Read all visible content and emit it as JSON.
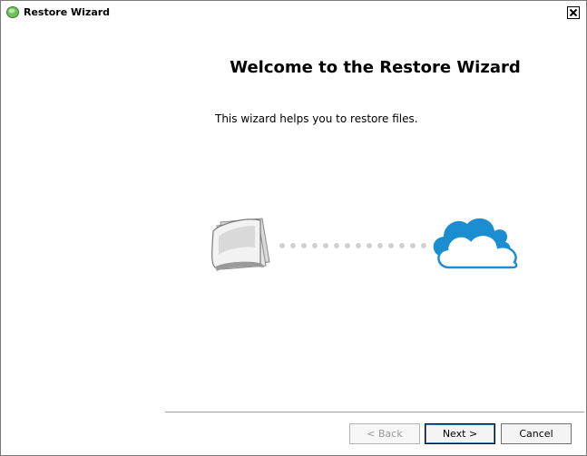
{
  "window": {
    "title": "Restore Wizard",
    "app_icon": "restore-wizard-icon",
    "close_icon": "close-icon"
  },
  "main": {
    "heading": "Welcome to the Restore Wizard",
    "description": "This wizard helps you to restore files.",
    "illustration": {
      "source_icon": "documents-icon",
      "target_icon": "cloud-icon",
      "cloud_color": "#1a8ed1"
    }
  },
  "footer": {
    "back_label": "< Back",
    "next_label": "Next >",
    "cancel_label": "Cancel"
  }
}
